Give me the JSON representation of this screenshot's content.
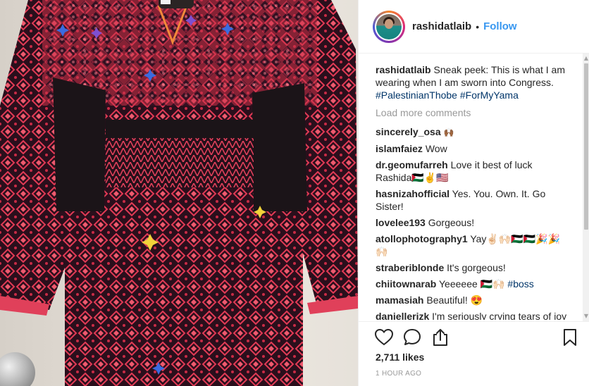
{
  "post": {
    "username": "rashidatlaib",
    "separator": "•",
    "follow_label": "Follow",
    "caption": {
      "username": "rashidatlaib",
      "text": "Sneak peek: This is what I am wearing when I am sworn into Congress.",
      "hashtags": [
        "#PalestinianThobe",
        "#ForMyYama"
      ]
    },
    "load_more_label": "Load more comments",
    "comments": [
      {
        "user": "sincerely_osa",
        "text": "🙌🏾"
      },
      {
        "user": "islamfaiez",
        "text": "Wow"
      },
      {
        "user": "dr.geomufarreh",
        "text": "Love it best of luck Rashida🇵🇸✌️🇺🇸"
      },
      {
        "user": "hasnizahofficial",
        "text": "Yes. You. Own. It. Go Sister!"
      },
      {
        "user": "lovelee193",
        "text": "Gorgeous!"
      },
      {
        "user": "atollophotography1",
        "text": "Yay✌🏻🙌🏻🇵🇸🇵🇸🎉🎉🙌🏻"
      },
      {
        "user": "straberiblonde",
        "text": "It's gorgeous!"
      },
      {
        "user": "chiitownarab",
        "text": "Yeeeeee 🇵🇸🙌🏻",
        "hashtag": "#boss"
      },
      {
        "user": "mamasiah",
        "text": "Beautiful! 😍"
      },
      {
        "user": "daniellerizk",
        "text": "I'm seriously crying tears of joy rn. I'm a very proud Palestinian"
      }
    ],
    "likes": "2,711 likes",
    "time": "1 HOUR AGO"
  },
  "icons": {
    "like": "heart-icon",
    "comment": "comment-icon",
    "share": "share-icon",
    "save": "bookmark-icon"
  },
  "colors": {
    "link": "#3897f0",
    "hashtag": "#003569",
    "thobe_black": "#1b1418",
    "thobe_red": "#d8344a"
  }
}
